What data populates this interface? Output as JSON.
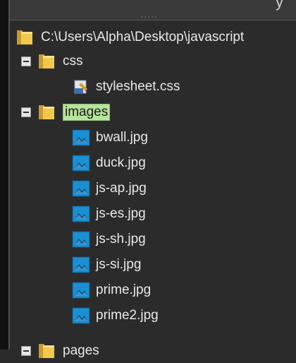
{
  "top_text": "y",
  "tree": {
    "root": {
      "label": "C:\\Users\\Alpha\\Desktop\\javascript",
      "icon": "folder-icon"
    },
    "css_folder": {
      "label": "css",
      "toggle": "collapse-toggle",
      "icon": "folder-icon"
    },
    "stylesheet": {
      "label": "stylesheet.css",
      "icon": "css-file-icon"
    },
    "images_folder": {
      "label": "images",
      "toggle": "collapse-toggle",
      "icon": "folder-icon",
      "selected": true
    },
    "files": [
      {
        "label": "bwall.jpg",
        "icon": "image-file-icon"
      },
      {
        "label": "duck.jpg",
        "icon": "image-file-icon"
      },
      {
        "label": "js-ap.jpg",
        "icon": "image-file-icon"
      },
      {
        "label": "js-es.jpg",
        "icon": "image-file-icon"
      },
      {
        "label": "js-sh.jpg",
        "icon": "image-file-icon"
      },
      {
        "label": "js-si.jpg",
        "icon": "image-file-icon"
      },
      {
        "label": "prime.jpg",
        "icon": "image-file-icon"
      },
      {
        "label": "prime2.jpg",
        "icon": "image-file-icon"
      }
    ],
    "pages_folder": {
      "label": "pages",
      "toggle": "collapse-toggle",
      "icon": "folder-icon"
    }
  },
  "colors": {
    "background": "#2b2b2b",
    "selection": "#b7e39c",
    "folder": "#f2c84b",
    "image_icon": "#1b8fd1"
  }
}
